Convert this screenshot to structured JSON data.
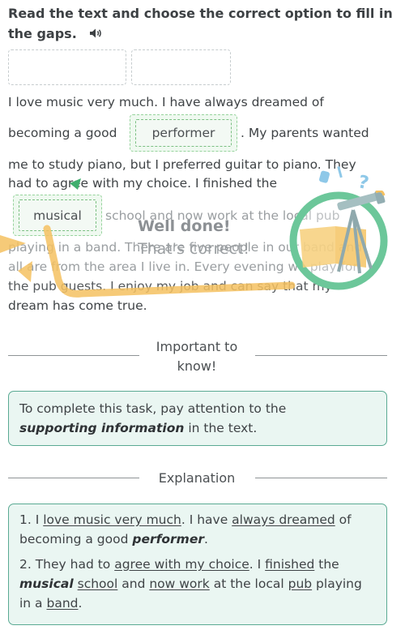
{
  "header": {
    "title": "Read the text and choose the correct option to fill in the gaps.",
    "audio_icon": "speaker-icon"
  },
  "answer_slots": [
    "",
    ""
  ],
  "passage": {
    "line1": "I love music very much. I have always dreamed of",
    "line2_before": "becoming a good",
    "gap1_answer": "performer",
    "line2_after": ". My parents wanted",
    "line3": "me to study piano, but I preferred guitar to piano. They",
    "line4": "had to agree with my choice. I finished the",
    "gap2_answer": "musical",
    "line5_after": "school and now work at the local pub",
    "line6": "playing in a band. There are five people in our band and",
    "line7": "all are from the area I live in. Every evening we play for",
    "line8": "the pub guests. I enjoy my job and can say that my",
    "line9": "dream has come true."
  },
  "feedback": {
    "headline": "Well done!",
    "message": "That's correct!",
    "illustration": "telescope-book-icon",
    "colors": {
      "ring": "#6cc79a",
      "ribbon": "#f5c160",
      "telescope": "#8fa9ad"
    }
  },
  "important": {
    "heading_line1": "Important to",
    "heading_line2": "know!",
    "text_before": "To complete this task, pay attention to the",
    "text_emphasis": "supporting information",
    "text_after": "in the text."
  },
  "explanation": {
    "heading": "Explanation",
    "item1": {
      "num": "1. I ",
      "u1": "love music very much",
      "t1": ". I have ",
      "u2": "always dreamed",
      "t2": " of becoming a good ",
      "bold": "performer",
      "t3": "."
    },
    "item2": {
      "num": "2. They had to ",
      "u1": "agree with my choice",
      "t1": ". I ",
      "u2": "finished",
      "t2": " the ",
      "bold": "musical",
      "t3": " ",
      "u3": "school",
      "t4": " and ",
      "u4": "now work",
      "t5": " at the local ",
      "u5": "pub",
      "t6": " playing in a ",
      "u6": "band",
      "t7": "."
    }
  },
  "colors": {
    "accent_green": "#5aaa93",
    "box_bg": "#eaf6f2",
    "gap_border": "#7bbf82"
  }
}
